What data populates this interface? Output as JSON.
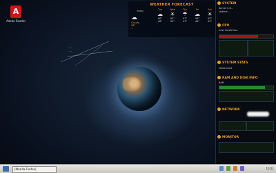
{
  "desktop": {
    "icon_label": "Adobe Reader"
  },
  "space_note": {
    "line1": "...",
    "line2": "..."
  },
  "weather": {
    "title": "WEATHER FORECAST",
    "sub": "Today",
    "now_lines": [
      "Cloudy",
      "58°",
      "..."
    ],
    "days": [
      {
        "day": "Tue",
        "icon": "☁",
        "hi": "60°",
        "lo": "48°"
      },
      {
        "day": "Wed",
        "icon": "☀",
        "hi": "62°",
        "lo": "50°"
      },
      {
        "day": "Thu",
        "icon": "☂",
        "hi": "57°",
        "lo": "47°"
      },
      {
        "day": "Fri",
        "icon": "☁",
        "hi": "59°",
        "lo": "46°"
      },
      {
        "day": "Sat",
        "icon": "☀",
        "hi": "63°",
        "lo": "49°"
      }
    ]
  },
  "panel": {
    "sections": {
      "sys": "SYSTEM",
      "cpu": "CPU",
      "stats": "SYSTEM STATS",
      "ram": "RAM AND DISK INFO",
      "network": "NETWORK",
      "monitor": "MONITOR"
    },
    "sys_lines": [
      "Kernel 2.6...",
      "Uptime ..."
    ],
    "cpu_label": "Intel Core2 Duo",
    "cpu_usage": 0.72,
    "stats_label": "Video Card",
    "ram_label": "RAM",
    "ram_usage": 0.85
  },
  "taskbar": {
    "task_label": "[Mozilla Firefox]",
    "clock": "10:21"
  }
}
